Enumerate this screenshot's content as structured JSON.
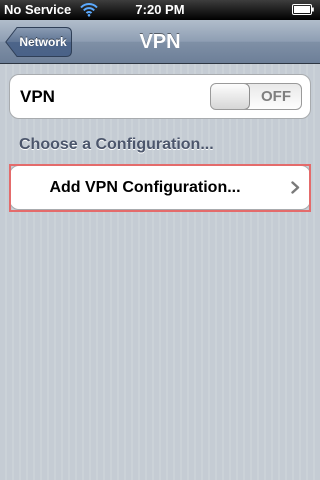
{
  "status_bar": {
    "carrier": "No Service",
    "time": "7:20 PM",
    "wifi_icon": "wifi-icon",
    "battery_icon": "battery-icon"
  },
  "nav_bar": {
    "back_label": "Network",
    "title": "VPN"
  },
  "vpn_row": {
    "label": "VPN",
    "toggle_state": "OFF"
  },
  "section": {
    "header": "Choose a Configuration..."
  },
  "config_row": {
    "label": "Add VPN Configuration...",
    "chevron_icon": "chevron-right-icon"
  },
  "colors": {
    "background": "#c5ccd4",
    "nav_bar": "#6d7f98",
    "section_header": "#4c566c",
    "highlight": "#e46b6b"
  }
}
